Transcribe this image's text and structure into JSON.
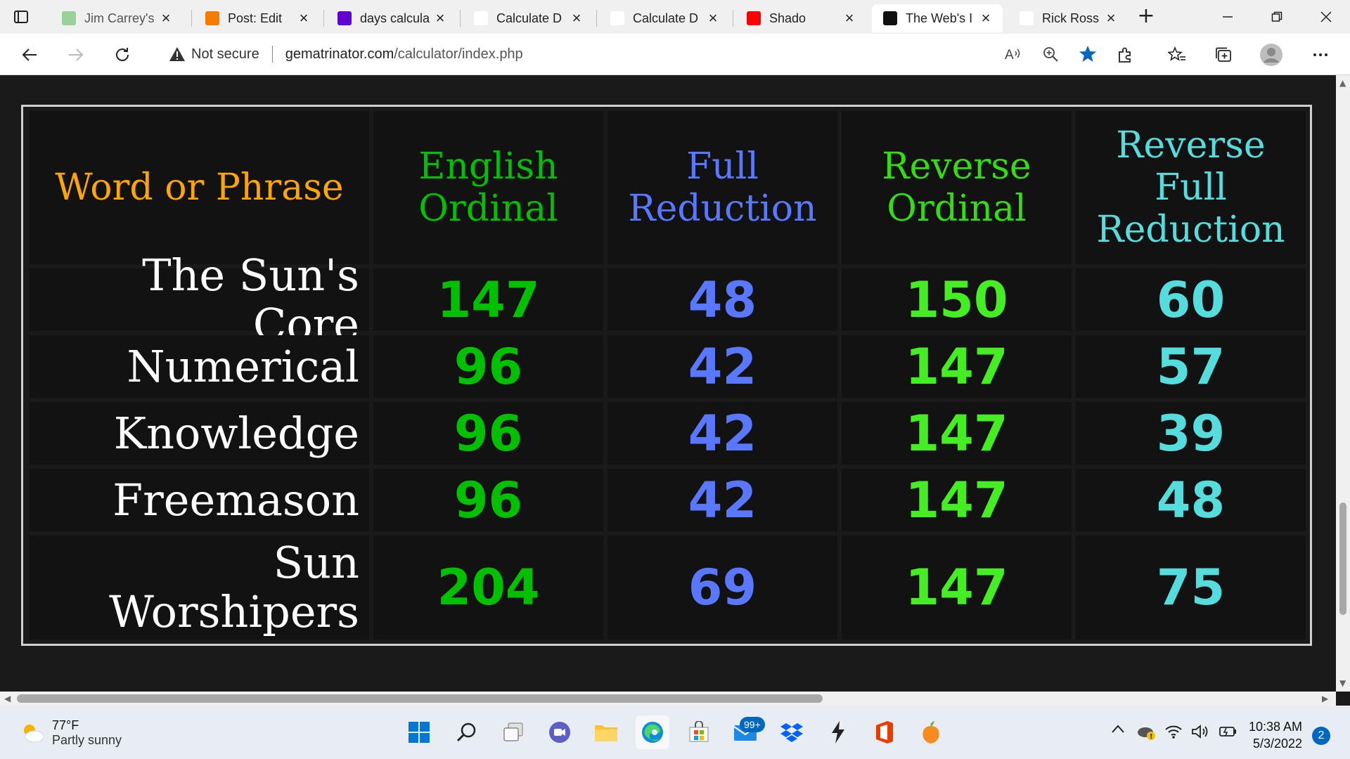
{
  "browser": {
    "tabs": [
      {
        "title": "Jim Carrey's",
        "favicon": "jc-wreath-icon",
        "fav_color": "#9ad09a"
      },
      {
        "title": "Post: Edit",
        "favicon": "blogger-icon",
        "fav_color": "#f57c00"
      },
      {
        "title": "days calcula",
        "favicon": "yahoo-icon",
        "fav_color": "#6001d2"
      },
      {
        "title": "Calculate D",
        "favicon": "colorful-dots-icon",
        "fav_color": "#ffffff"
      },
      {
        "title": "Calculate D",
        "favicon": "colorful-dots-icon",
        "fav_color": "#ffffff"
      },
      {
        "title": "Shado",
        "favicon": "youtube-icon",
        "fav_color": "#ff0000"
      },
      {
        "title": "The Web's I",
        "favicon": "gematrinator-icon",
        "fav_color": "#111111"
      },
      {
        "title": "Rick Ross –",
        "favicon": "genius-icon",
        "fav_color": "#ffffff"
      }
    ],
    "security_label": "Not secure",
    "url_host": "gematrinator.com",
    "url_path": "/calculator/index.php"
  },
  "table": {
    "headers": [
      {
        "label": "Word or Phrase",
        "color": "#ffa500"
      },
      {
        "label": "English\nOrdinal",
        "color": "#00c000"
      },
      {
        "label": "Full\nReduction",
        "color": "#5a78ff"
      },
      {
        "label": "Reverse\nOrdinal",
        "color": "#33dd11"
      },
      {
        "label": "Reverse\nFull\nReduction",
        "color": "#55dddd"
      }
    ],
    "rows": [
      {
        "phrase": "The Sun's Core",
        "values": [
          "147",
          "48",
          "150",
          "60"
        ]
      },
      {
        "phrase": "Numerical",
        "values": [
          "96",
          "42",
          "147",
          "57"
        ]
      },
      {
        "phrase": "Knowledge",
        "values": [
          "96",
          "42",
          "147",
          "39"
        ]
      },
      {
        "phrase": "Freemason",
        "values": [
          "96",
          "42",
          "147",
          "48"
        ]
      },
      {
        "phrase": "Sun\nWorshipers",
        "values": [
          "204",
          "69",
          "147",
          "75"
        ]
      }
    ],
    "value_colors": [
      "#00c000",
      "#5a78ff",
      "#44ee22",
      "#55dddd"
    ]
  },
  "taskbar": {
    "weather_temp": "77°F",
    "weather_desc": "Partly sunny",
    "mail_badge": "99+",
    "time": "10:38 AM",
    "date": "5/3/2022",
    "notifications": "2"
  }
}
